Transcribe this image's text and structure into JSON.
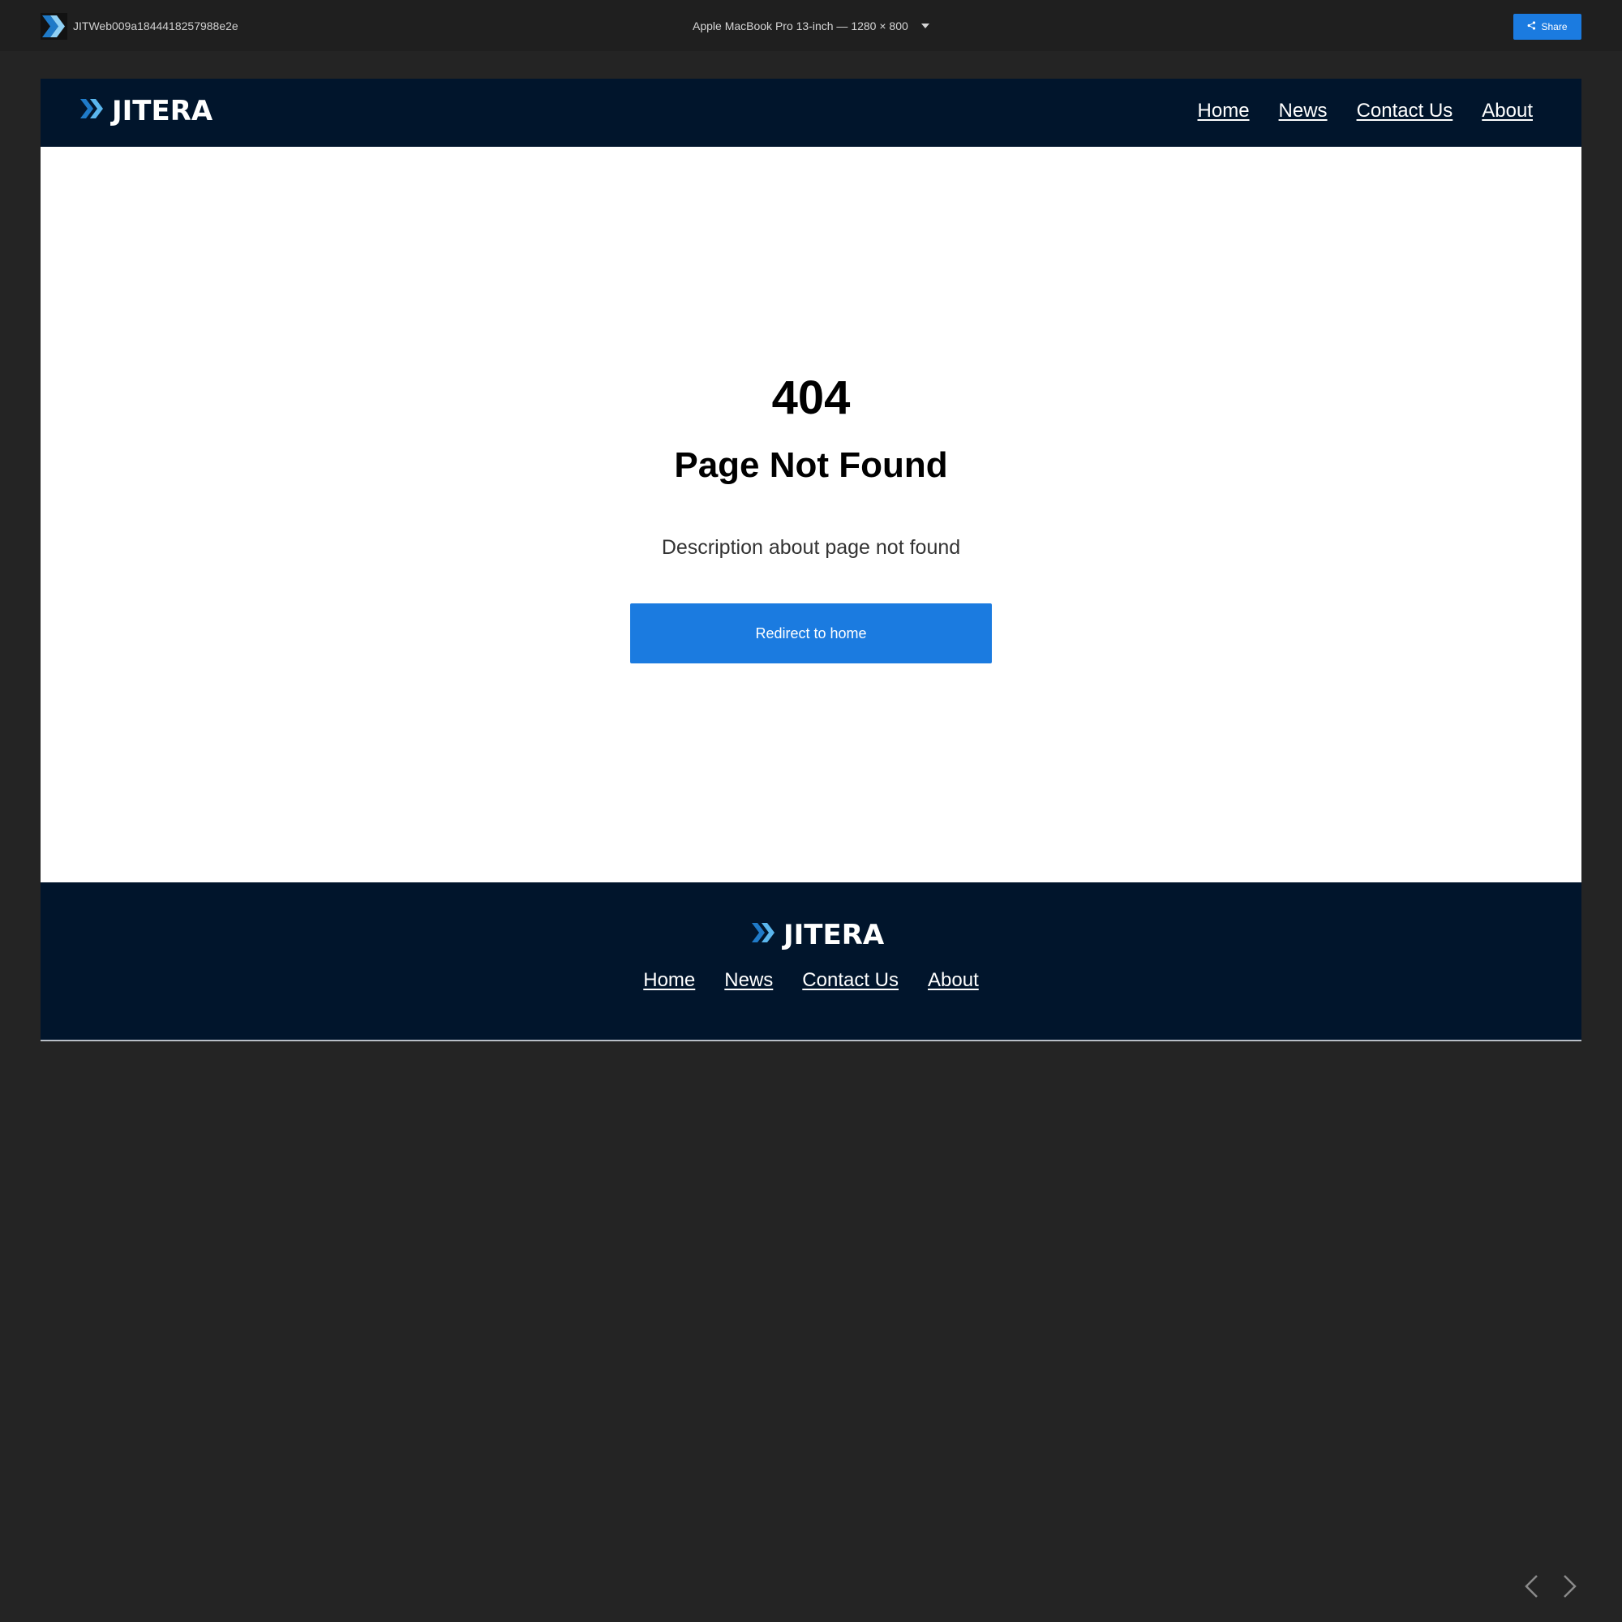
{
  "viewer": {
    "project_id": "JITWeb009a1844418257988e2e",
    "device": "Apple MacBook Pro 13-inch — 1280 × 800",
    "share_label": "Share",
    "icons": {
      "app": "jitera-chevrons-icon",
      "device_dropdown": "chevron-down-icon",
      "share": "share-icon",
      "prev": "chevron-left-icon",
      "next": "chevron-right-icon"
    }
  },
  "site": {
    "brand": "JITERA",
    "nav": [
      "Home",
      "News",
      "Contact Us",
      "About"
    ],
    "error": {
      "code": "404",
      "title": "Page Not Found",
      "description": "Description about page not found",
      "button_label": "Redirect to home"
    },
    "footer_nav": [
      "Home",
      "News",
      "Contact Us",
      "About"
    ]
  },
  "colors": {
    "viewer_bg": "#242424",
    "viewer_bar": "#1f1f1f",
    "accent_blue": "#1b7be0",
    "site_navy": "#01152c",
    "logo_chevron_dark": "#1f7ac8",
    "logo_chevron_light": "#5ab6ee"
  }
}
